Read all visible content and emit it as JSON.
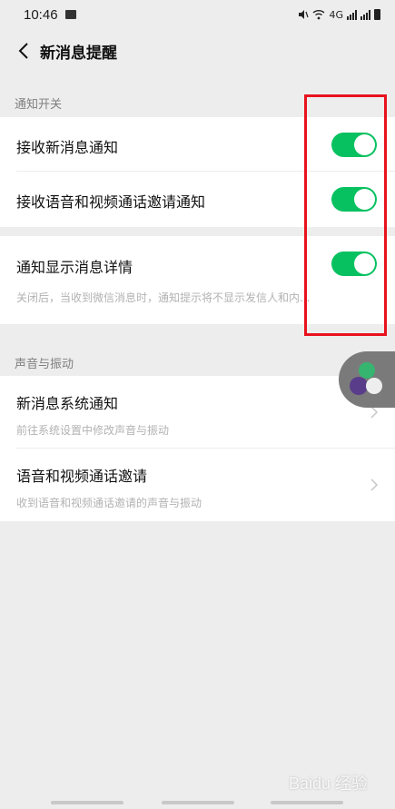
{
  "status_bar": {
    "time": "10:46",
    "signal_text": "4G"
  },
  "header": {
    "title": "新消息提醒"
  },
  "sections": {
    "notify_switch": {
      "label": "通知开关",
      "rows": [
        {
          "title": "接收新消息通知",
          "enabled": true
        },
        {
          "title": "接收语音和视频通话邀请通知",
          "enabled": true
        }
      ]
    },
    "details": {
      "title": "通知显示消息详情",
      "enabled": true,
      "description": "关闭后，当收到微信消息时，通知提示将不显示发信人和内..."
    },
    "sound_vibrate": {
      "label": "声音与振动",
      "rows": [
        {
          "title": "新消息系统通知",
          "subtitle": "前往系统设置中修改声音与振动"
        },
        {
          "title": "语音和视频通话邀请",
          "subtitle": "收到语音和视频通话邀请的声音与振动"
        }
      ]
    }
  },
  "watermark": "Baidu 经验",
  "colors": {
    "toggle_on": "#07c160",
    "highlight": "#e8121d",
    "background": "#ededed"
  }
}
